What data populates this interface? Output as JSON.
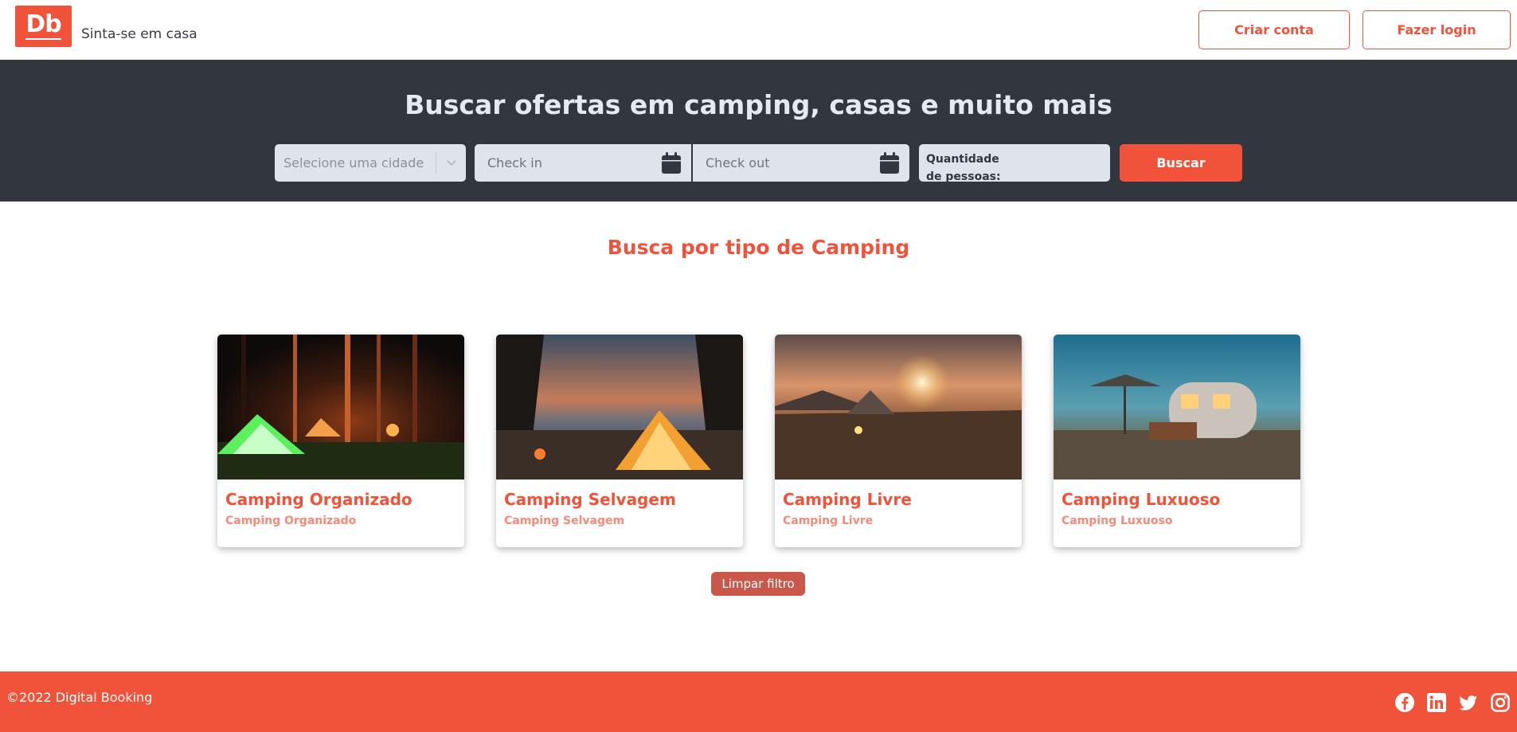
{
  "header": {
    "logo_text": "Db",
    "tagline": "Sinta-se em casa",
    "create_account_label": "Criar conta",
    "login_label": "Fazer login"
  },
  "search": {
    "title": "Buscar ofertas em camping, casas e muito mais",
    "city_placeholder": "Selecione uma cidade",
    "checkin_placeholder": "Check in",
    "checkout_placeholder": "Check out",
    "guests_label_line1": "Quantidade",
    "guests_label_line2": "de pessoas:",
    "search_button": "Buscar"
  },
  "categories": {
    "title": "Busca por tipo de Camping",
    "items": [
      {
        "title": "Camping Organizado",
        "subtitle": "Camping Organizado"
      },
      {
        "title": "Camping Selvagem",
        "subtitle": "Camping Selvagem"
      },
      {
        "title": "Camping Livre",
        "subtitle": "Camping Livre"
      },
      {
        "title": "Camping Luxuoso",
        "subtitle": "Camping Luxuoso"
      }
    ],
    "clear_filter_label": "Limpar filtro"
  },
  "footer": {
    "copyright": "©2022 Digital Booking",
    "social_icons": [
      "facebook-icon",
      "linkedin-icon",
      "twitter-icon",
      "instagram-icon"
    ]
  },
  "colors": {
    "brand": "#f0533a",
    "banner_bg": "#31363f",
    "field_bg": "#dfe3ec"
  }
}
